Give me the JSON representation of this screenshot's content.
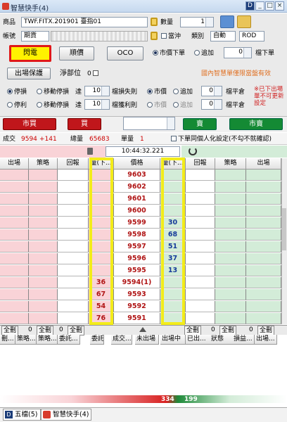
{
  "window": {
    "title": "智慧快手(4)",
    "min": "_",
    "max": "□",
    "close": "×"
  },
  "form": {
    "product_label": "商品",
    "product_value": "TWF.FITX.201901 臺指01",
    "qty_label": "數量",
    "qty_value": "1",
    "account_label": "帳號",
    "account_type": "期貨",
    "day_trade_label": "當沖",
    "category_label": "類別",
    "category_value": "自動",
    "rod_value": "ROD"
  },
  "mode_buttons": {
    "flash": "閃電",
    "straight": "順價",
    "oco": "OCO"
  },
  "order_type": {
    "market_label": "市價下單",
    "add_label": "追加",
    "tick_value": "0",
    "tick_unit": "檔下單"
  },
  "exit_row": {
    "exit_btn": "出場保護",
    "net_label": "淨部位",
    "net_value": "0",
    "notice": "國內智慧單僅限當盤有效"
  },
  "stop_rows": {
    "stop_loss": "停損",
    "trail_stop": "移動停損",
    "reach": "達",
    "value1": "10",
    "ticks_loss": "檔損失則",
    "market": "市價",
    "add": "追加",
    "value_b": "0",
    "ticks_exit": "檔平倉",
    "stop_profit": "停利",
    "trail_profit": "移動停損",
    "value2": "10",
    "ticks_profit": "檔獲利則",
    "warning": "※已下出場單不可更新設定"
  },
  "actions": {
    "market_buy": "市買",
    "buy": "買",
    "sell": "賣",
    "market_sell": "市賣"
  },
  "quote": {
    "deal_label": "成交",
    "deal_price": "9594",
    "deal_change": "+141",
    "total_label": "總量",
    "total_value": "65683",
    "single_label": "單量",
    "single_value": "1",
    "auto_set": "下單同個人化設定(不勾不就確認)",
    "time": "10:44:32.221"
  },
  "ladder_headers": [
    "出場",
    "策略",
    "回報",
    "量(下...",
    "價格",
    "量(下...",
    "回報",
    "策略",
    "出場"
  ],
  "ladder_rows": [
    {
      "bid": "",
      "price": "9603",
      "ask": ""
    },
    {
      "bid": "",
      "price": "9602",
      "ask": ""
    },
    {
      "bid": "",
      "price": "9601",
      "ask": ""
    },
    {
      "bid": "",
      "price": "9600",
      "ask": ""
    },
    {
      "bid": "",
      "price": "9599",
      "ask": "30"
    },
    {
      "bid": "",
      "price": "9598",
      "ask": "68"
    },
    {
      "bid": "",
      "price": "9597",
      "ask": "51"
    },
    {
      "bid": "",
      "price": "9596",
      "ask": "37"
    },
    {
      "bid": "",
      "price": "9595",
      "ask": "13"
    },
    {
      "bid": "36",
      "price": "9594(1)",
      "ask": ""
    },
    {
      "bid": "67",
      "price": "9593",
      "ask": ""
    },
    {
      "bid": "54",
      "price": "9592",
      "ask": ""
    },
    {
      "bid": "76",
      "price": "9591",
      "ask": ""
    }
  ],
  "delete_bar": {
    "all_del": "全刪",
    "zero": "0"
  },
  "bottom_headers": [
    "刪...",
    "策略...",
    "策略...",
    "委託...",
    "委託...",
    "成交...",
    "未出場",
    "出場中",
    "已出...",
    "狀態",
    "損益...",
    "出場..."
  ],
  "footer": {
    "sell_strength": "334",
    "buy_strength": "199"
  },
  "tabs": [
    "五檔(5)",
    "智慧快手(4)"
  ],
  "colors": {
    "bid_bg": "#f9d3d7",
    "ask_bg": "#d3ecd8",
    "highlight": "#f3ec1a",
    "buy": "#c0161b",
    "sell": "#148a34"
  }
}
